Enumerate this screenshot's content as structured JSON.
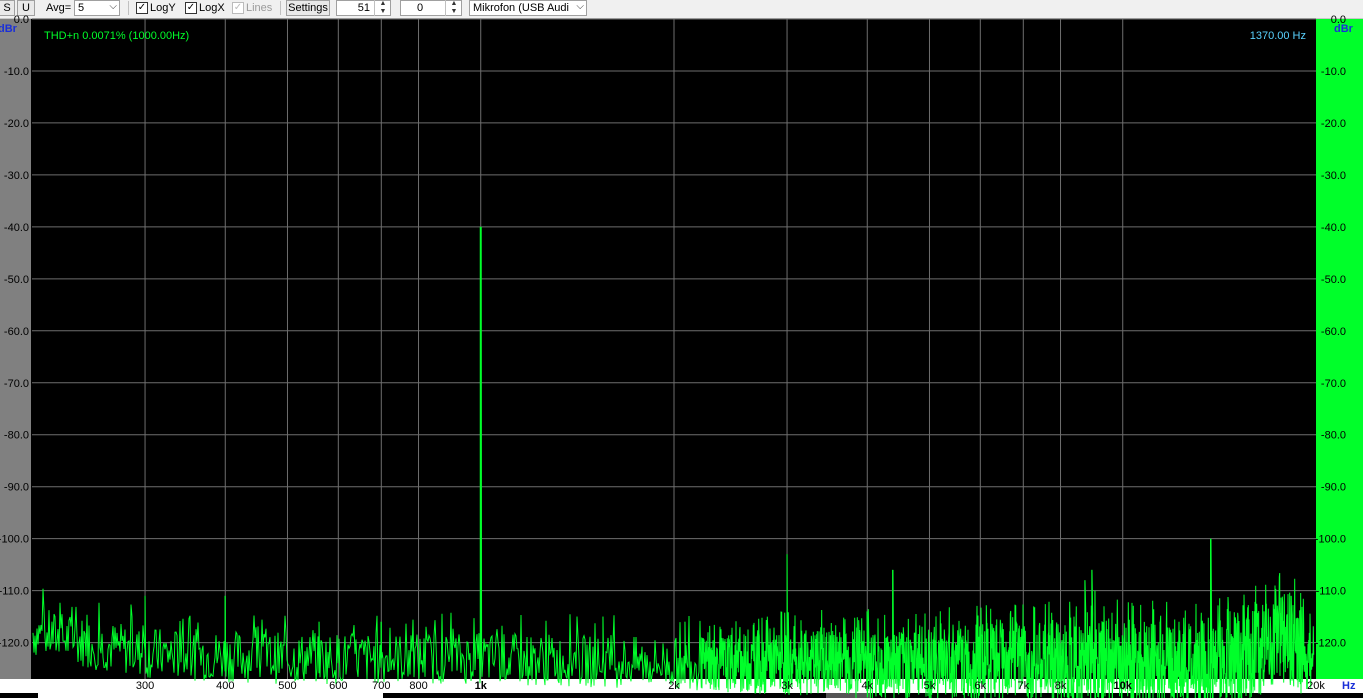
{
  "toolbar": {
    "s_label": "S",
    "u_label": "U",
    "avg_label": "Avg=",
    "avg_value": "5",
    "logy_label": "LogY",
    "logy_checked": true,
    "logx_label": "LogX",
    "logx_checked": true,
    "lines_label": "Lines",
    "lines_checked": true,
    "lines_enabled": false,
    "settings_label": "Settings",
    "spin1_value": "51",
    "spin2_value": "0",
    "device_value": "Mikrofon (USB Audi"
  },
  "colors": {
    "background": "#000000",
    "trace": "#00ff2a",
    "grid": "#6e6e6e",
    "left_axis_bg": "#808080",
    "right_axis_bg": "#00ff2a",
    "unit_label": "#1a2fd8",
    "thd_text": "#00ff2a",
    "cursor_text": "#5ad2ff"
  },
  "chart_data": {
    "type": "line",
    "title": "",
    "annotation_left": "THD+n 0.0071% (1000.00Hz)",
    "annotation_right": "1370.00 Hz",
    "xlabel": "Hz",
    "ylabel_left": "dBr",
    "ylabel_right": "dBr",
    "x_scale": "log",
    "xlim": [
      200,
      20000
    ],
    "ylim": [
      -127,
      0
    ],
    "grid": true,
    "x_ticks": [
      {
        "value": 300,
        "label": "300",
        "bold": false
      },
      {
        "value": 400,
        "label": "400",
        "bold": false
      },
      {
        "value": 500,
        "label": "500",
        "bold": false
      },
      {
        "value": 600,
        "label": "600",
        "bold": false
      },
      {
        "value": 700,
        "label": "700",
        "bold": false
      },
      {
        "value": 800,
        "label": "800",
        "bold": false
      },
      {
        "value": 1000,
        "label": "1k",
        "bold": true
      },
      {
        "value": 2000,
        "label": "2k",
        "bold": false
      },
      {
        "value": 3000,
        "label": "3k",
        "bold": false
      },
      {
        "value": 4000,
        "label": "4k",
        "bold": false
      },
      {
        "value": 5000,
        "label": "5k",
        "bold": false
      },
      {
        "value": 6000,
        "label": "6k",
        "bold": false
      },
      {
        "value": 7000,
        "label": "7k",
        "bold": false
      },
      {
        "value": 8000,
        "label": "8k",
        "bold": false
      },
      {
        "value": 10000,
        "label": "10k",
        "bold": true
      },
      {
        "value": 20000,
        "label": "20k",
        "bold": false
      }
    ],
    "y_ticks": [
      {
        "value": 0,
        "label": "0.0"
      },
      {
        "value": -10,
        "label": "-10.0"
      },
      {
        "value": -20,
        "label": "-20.0"
      },
      {
        "value": -30,
        "label": "-30.0"
      },
      {
        "value": -40,
        "label": "-40.0"
      },
      {
        "value": -50,
        "label": "-50.0"
      },
      {
        "value": -60,
        "label": "-60.0"
      },
      {
        "value": -70,
        "label": "-70.0"
      },
      {
        "value": -80,
        "label": "-80.0"
      },
      {
        "value": -90,
        "label": "-90.0"
      },
      {
        "value": -100,
        "label": "-100.0"
      },
      {
        "value": -110,
        "label": "-110.0"
      },
      {
        "value": -120,
        "label": "-120.0"
      }
    ],
    "series": [
      {
        "noise_floor_db": [
          [
            200,
            -118
          ],
          [
            300,
            -122
          ],
          [
            500,
            -123
          ],
          [
            1000,
            -123
          ],
          [
            2000,
            -124
          ],
          [
            3000,
            -124
          ],
          [
            5000,
            -124
          ],
          [
            8000,
            -124
          ],
          [
            10000,
            -124
          ],
          [
            14000,
            -124
          ],
          [
            15000,
            -123
          ],
          [
            16500,
            -121
          ],
          [
            17500,
            -119
          ],
          [
            18500,
            -120
          ],
          [
            19300,
            -123
          ],
          [
            20000,
            -125
          ]
        ],
        "noise_band_db": [
          [
            200,
            5
          ],
          [
            1000,
            5
          ],
          [
            2000,
            5
          ],
          [
            4000,
            7
          ],
          [
            8000,
            8
          ],
          [
            14000,
            9
          ],
          [
            19000,
            9
          ],
          [
            20000,
            4
          ]
        ],
        "peaks": [
          {
            "freq": 300,
            "db": -111
          },
          {
            "freq": 400,
            "db": -111
          },
          {
            "freq": 560,
            "db": -116
          },
          {
            "freq": 700,
            "db": -116
          },
          {
            "freq": 1000,
            "db": -40
          },
          {
            "freq": 1550,
            "db": -115
          },
          {
            "freq": 2080,
            "db": -116
          },
          {
            "freq": 3000,
            "db": -103
          },
          {
            "freq": 4000,
            "db": -114
          },
          {
            "freq": 4380,
            "db": -106
          },
          {
            "freq": 8730,
            "db": -108
          },
          {
            "freq": 8950,
            "db": -106
          },
          {
            "freq": 9050,
            "db": -110
          },
          {
            "freq": 13700,
            "db": -100
          },
          {
            "freq": 16600,
            "db": -114
          },
          {
            "freq": 18300,
            "db": -111
          }
        ]
      }
    ]
  }
}
